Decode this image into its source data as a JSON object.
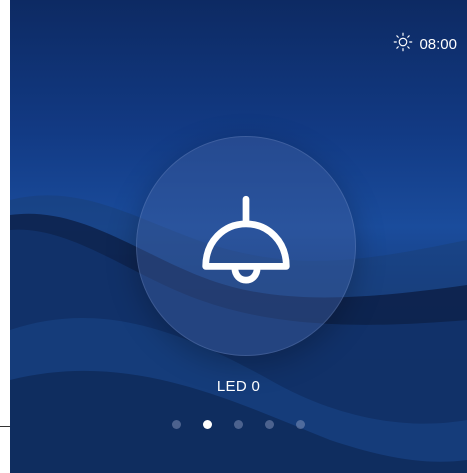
{
  "status": {
    "time": "08:00",
    "weather_icon": "sun-icon"
  },
  "device": {
    "name": "LED 0",
    "icon": "pendant-lamp-icon"
  },
  "pagination": {
    "count": 5,
    "active_index": 1
  },
  "colors": {
    "background_top": "#0d2a63",
    "background_mid": "#1a4c9c",
    "background_bottom": "#0f2a5c",
    "accent_text": "#ffffff",
    "dot_inactive": "#7f8fb8"
  }
}
